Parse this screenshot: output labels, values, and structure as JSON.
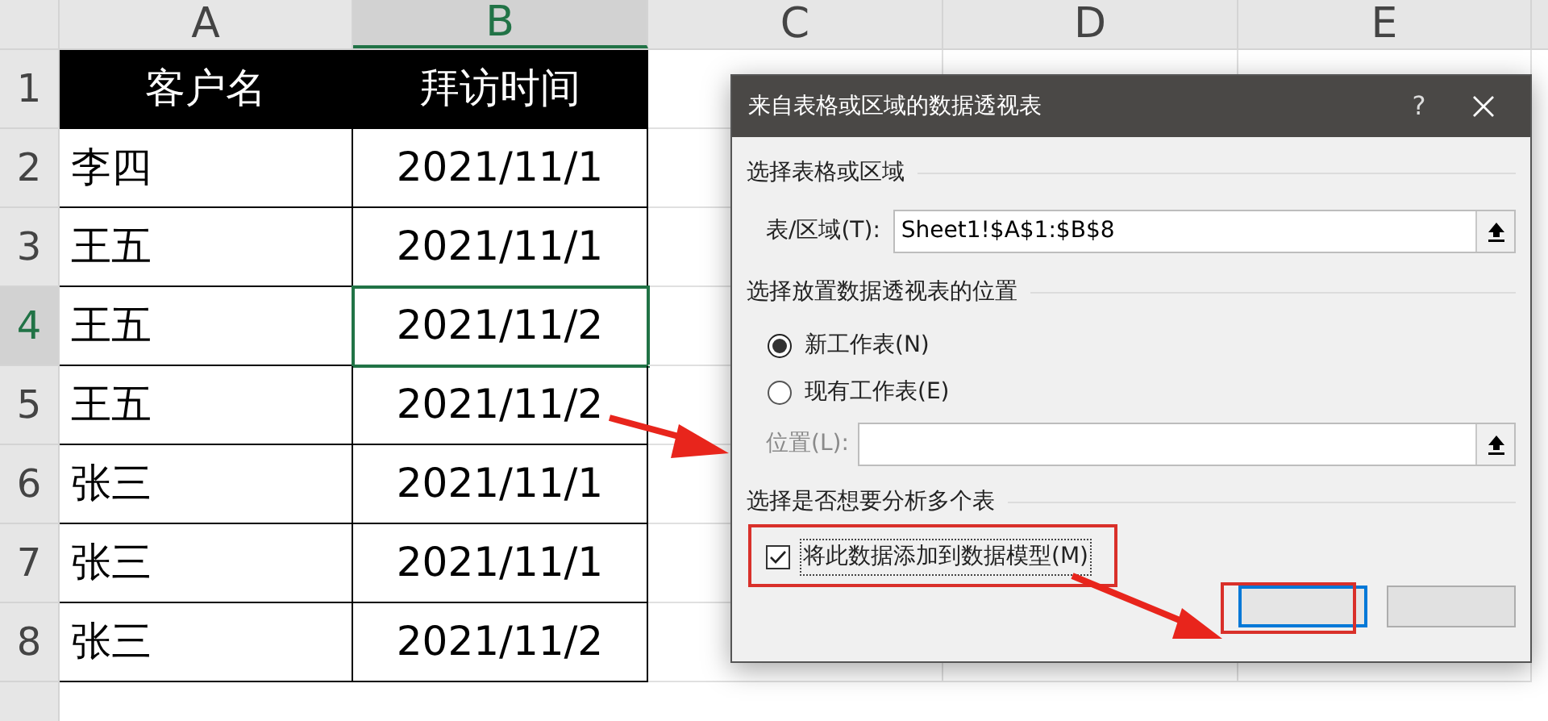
{
  "sheet": {
    "columns": [
      {
        "letter": "A",
        "selected": false
      },
      {
        "letter": "B",
        "selected": true
      },
      {
        "letter": "C",
        "selected": false
      },
      {
        "letter": "D",
        "selected": false
      },
      {
        "letter": "E",
        "selected": false
      }
    ],
    "header": {
      "number": "1",
      "name": "客户名",
      "date": "拜访时间"
    },
    "rows": [
      {
        "number": "2",
        "name": "李四",
        "date": "2021/11/1",
        "selected": false
      },
      {
        "number": "3",
        "name": "王五",
        "date": "2021/11/1",
        "selected": false
      },
      {
        "number": "4",
        "name": "王五",
        "date": "2021/11/2",
        "selected": true
      },
      {
        "number": "5",
        "name": "王五",
        "date": "2021/11/2",
        "selected": false
      },
      {
        "number": "6",
        "name": "张三",
        "date": "2021/11/1",
        "selected": false
      },
      {
        "number": "7",
        "name": "张三",
        "date": "2021/11/1",
        "selected": false
      },
      {
        "number": "8",
        "name": "张三",
        "date": "2021/11/2",
        "selected": false
      }
    ]
  },
  "dialog": {
    "title": "来自表格或区域的数据透视表",
    "help": "?",
    "section_source": "选择表格或区域",
    "range_label": "表/区域(T):",
    "range_value": "Sheet1!$A$1:$B$8",
    "section_location": "选择放置数据透视表的位置",
    "radios": [
      {
        "label": "新工作表(N)",
        "selected": true
      },
      {
        "label": "现有工作表(E)",
        "selected": false
      }
    ],
    "location_label": "位置(L):",
    "location_disabled": true,
    "section_model": "选择是否想要分析多个表",
    "model_checkbox": {
      "label": "将此数据添加到数据模型(M)",
      "checked": true
    }
  }
}
